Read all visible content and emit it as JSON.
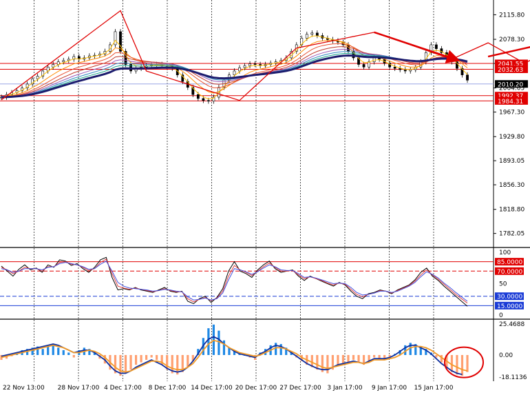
{
  "chart_data": [
    {
      "panel": "price",
      "type": "candlestick",
      "title": "",
      "y_axis_labels": [
        "2115.80",
        "2078.30",
        "2041.55",
        "2004.05",
        "1967.30",
        "1929.80",
        "1893.05",
        "1856.30",
        "1818.80",
        "1782.05"
      ],
      "ylim": [
        1768.0,
        2132.0
      ],
      "x_axis_labels": [
        "22 Nov 13:00",
        "28 Nov 17:00",
        "4 Dec 17:00",
        "8 Dec 17:00",
        "14 Dec 17:00",
        "20 Dec 17:00",
        "27 Dec 17:00",
        "3 Jan 17:00",
        "9 Jan 17:00",
        "15 Jan 17:00"
      ],
      "close_series": [
        1990,
        1994,
        1997,
        2000,
        2004,
        2010,
        2018,
        2022,
        2030,
        2036,
        2040,
        2044,
        2046,
        2048,
        2052,
        2048,
        2050,
        2053,
        2054,
        2056,
        2060,
        2070,
        2090,
        2060,
        2040,
        2030,
        2034,
        2036,
        2038,
        2039,
        2040,
        2038,
        2037,
        2034,
        2024,
        2014,
        2005,
        1994,
        1988,
        1985,
        1984,
        1990,
        2005,
        2016,
        2024,
        2030,
        2035,
        2038,
        2041,
        2040,
        2038,
        2040,
        2042,
        2044,
        2046,
        2050,
        2060,
        2070,
        2080,
        2086,
        2088,
        2084,
        2080,
        2078,
        2076,
        2074,
        2070,
        2060,
        2050,
        2040,
        2036,
        2044,
        2050,
        2048,
        2042,
        2036,
        2034,
        2032,
        2030,
        2032,
        2036,
        2044,
        2058,
        2070,
        2064,
        2058,
        2050,
        2044,
        2034,
        2024,
        2016
      ],
      "horizontal_levels": [
        {
          "value": 2041.55,
          "label": "2041.55",
          "color": "#e00000"
        },
        {
          "value": 2032.63,
          "label": "2032.63",
          "color": "#e00000"
        },
        {
          "value": 2010.2,
          "label": "2010.20",
          "color": "#000000"
        },
        {
          "value": 1992.37,
          "label": "1992.37",
          "color": "#e00000"
        },
        {
          "value": 1984.31,
          "label": "1984.31",
          "color": "#e00000"
        }
      ],
      "zigzag_points": [
        [
          0,
          1986
        ],
        [
          23,
          2122
        ],
        [
          28,
          2030
        ],
        [
          46,
          1985
        ],
        [
          57,
          2065
        ],
        [
          72,
          2089
        ],
        [
          87,
          2048
        ],
        [
          94,
          2073
        ],
        [
          101,
          2042
        ],
        [
          110,
          2074
        ],
        [
          117,
          2034
        ]
      ],
      "arrows": [
        {
          "from": [
            72,
            2089
          ],
          "to": [
            88,
            2047
          ]
        },
        {
          "from": [
            94,
            2052
          ],
          "to": [
            108,
            2077
          ]
        },
        {
          "from": [
            110,
            2074
          ],
          "to": [
            121,
            2026
          ]
        },
        {
          "from": [
            119,
            2004
          ],
          "to": [
            126,
            1990
          ]
        },
        {
          "from": [
            119,
            2016
          ],
          "to": [
            127,
            2047
          ]
        }
      ],
      "colors": {
        "up": "#000000",
        "down": "#000000",
        "ribbon_fast": "#ffc000",
        "ribbon_slow": "#27a844",
        "ma_main": "#1c1c6e",
        "levels": "#e00000"
      }
    },
    {
      "panel": "stochastic",
      "type": "line",
      "y_axis_labels": [
        "100",
        "85.0000",
        "70.0000",
        "50",
        "30.0000",
        "15.0000",
        "0"
      ],
      "ylim": [
        0,
        100
      ],
      "levels": [
        85,
        70,
        30,
        15
      ],
      "series": [
        {
          "color": "#000000",
          "values": [
            78,
            70,
            62,
            73,
            80,
            72,
            75,
            68,
            80,
            76,
            88,
            86,
            79,
            82,
            74,
            68,
            76,
            88,
            92,
            60,
            40,
            42,
            40,
            44,
            40,
            38,
            36,
            40,
            44,
            38,
            36,
            38,
            22,
            18,
            26,
            30,
            20,
            28,
            42,
            70,
            85,
            70,
            66,
            60,
            72,
            80,
            86,
            74,
            68,
            70,
            72,
            62,
            55,
            62,
            58,
            54,
            50,
            46,
            52,
            48,
            38,
            30,
            26,
            34,
            36,
            40,
            38,
            34,
            40,
            44,
            48,
            56,
            68,
            75,
            62,
            55,
            46,
            38,
            30,
            22,
            14
          ]
        },
        {
          "color": "#e04040",
          "values": [
            76,
            72,
            66,
            70,
            76,
            74,
            74,
            70,
            77,
            77,
            84,
            85,
            81,
            80,
            76,
            71,
            74,
            84,
            89,
            66,
            46,
            43,
            41,
            43,
            41,
            39,
            37,
            39,
            42,
            39,
            37,
            37,
            26,
            21,
            25,
            28,
            23,
            27,
            38,
            62,
            79,
            72,
            68,
            63,
            70,
            77,
            83,
            76,
            70,
            70,
            71,
            64,
            58,
            61,
            58,
            55,
            51,
            48,
            51,
            49,
            41,
            33,
            29,
            33,
            35,
            39,
            38,
            35,
            39,
            43,
            47,
            54,
            64,
            72,
            64,
            57,
            49,
            41,
            33,
            26,
            19
          ]
        },
        {
          "color": "#4050e0",
          "values": [
            74,
            72,
            68,
            70,
            74,
            74,
            74,
            72,
            76,
            77,
            82,
            84,
            82,
            80,
            77,
            73,
            74,
            81,
            86,
            70,
            52,
            46,
            43,
            42,
            41,
            40,
            38,
            39,
            41,
            40,
            38,
            37,
            29,
            24,
            25,
            27,
            24,
            26,
            35,
            56,
            74,
            72,
            69,
            65,
            69,
            75,
            80,
            77,
            72,
            71,
            71,
            66,
            60,
            61,
            59,
            56,
            53,
            50,
            51,
            50,
            44,
            36,
            32,
            33,
            35,
            38,
            38,
            36,
            38,
            42,
            46,
            52,
            61,
            69,
            65,
            59,
            51,
            44,
            36,
            29,
            22
          ]
        }
      ]
    },
    {
      "panel": "macd",
      "type": "bar",
      "y_axis_labels": [
        "25.4688",
        "0.00",
        "-18.1136"
      ],
      "ylim": [
        -18.1136,
        25.4688
      ],
      "histogram": [
        -4,
        -3,
        -1,
        2,
        4,
        5,
        6,
        7,
        5,
        8,
        9,
        6,
        4,
        2,
        -2,
        4,
        6,
        5,
        2,
        -3,
        -7,
        -12,
        -15,
        -17,
        -15,
        -12,
        -8,
        -6,
        -4,
        -2,
        -4,
        -8,
        -12,
        -15,
        -16,
        -14,
        -10,
        -5,
        5,
        14,
        22,
        25,
        20,
        12,
        6,
        4,
        2,
        0,
        -2,
        -4,
        2,
        5,
        8,
        10,
        9,
        6,
        3,
        -2,
        -5,
        -8,
        -10,
        -12,
        -14,
        -15,
        -12,
        -9,
        -8,
        -6,
        -4,
        -6,
        -8,
        -5,
        -2,
        -3,
        -4,
        -2,
        1,
        4,
        8,
        10,
        9,
        7,
        5,
        2,
        -2,
        -6,
        -10,
        -14,
        -16,
        -17,
        -14
      ],
      "signal_line": [
        -2,
        -1,
        0,
        1,
        2,
        3,
        4,
        5,
        6,
        7,
        8,
        7,
        6,
        4,
        2,
        2,
        3,
        4,
        3,
        1,
        -2,
        -6,
        -10,
        -13,
        -14,
        -13,
        -11,
        -9,
        -7,
        -5,
        -5,
        -6,
        -9,
        -11,
        -12,
        -12,
        -10,
        -7,
        -2,
        4,
        9,
        12,
        11,
        9,
        6,
        4,
        2,
        1,
        0,
        -1,
        0,
        2,
        4,
        6,
        6,
        5,
        3,
        1,
        -2,
        -4,
        -6,
        -8,
        -10,
        -11,
        -10,
        -9,
        -8,
        -7,
        -6,
        -6,
        -7,
        -6,
        -4,
        -4,
        -4,
        -3,
        -2,
        0,
        3,
        6,
        7,
        7,
        6,
        4,
        1,
        -2,
        -5,
        -8,
        -10,
        -12,
        -13
      ],
      "main_line": [
        -1,
        0,
        1,
        2,
        3,
        4,
        5,
        6,
        7,
        8,
        9,
        8,
        6,
        4,
        2,
        3,
        4,
        4,
        2,
        -1,
        -4,
        -9,
        -13,
        -15,
        -15,
        -13,
        -10,
        -8,
        -6,
        -4,
        -6,
        -8,
        -11,
        -13,
        -14,
        -13,
        -10,
        -5,
        1,
        8,
        13,
        15,
        13,
        9,
        6,
        3,
        1,
        0,
        -1,
        -2,
        1,
        3,
        6,
        8,
        7,
        5,
        2,
        -1,
        -4,
        -7,
        -9,
        -11,
        -12,
        -12,
        -10,
        -8,
        -7,
        -6,
        -5,
        -6,
        -7,
        -5,
        -3,
        -3,
        -3,
        -2,
        0,
        3,
        6,
        8,
        8,
        6,
        4,
        1,
        -3,
        -7,
        -10,
        -13,
        -15,
        -16
      ],
      "colors": {
        "positive": "#1e88e5",
        "negative": "#ff9f70",
        "main": "#0d2ea0",
        "signal": "#f29a26"
      },
      "annotation": "circle"
    }
  ]
}
